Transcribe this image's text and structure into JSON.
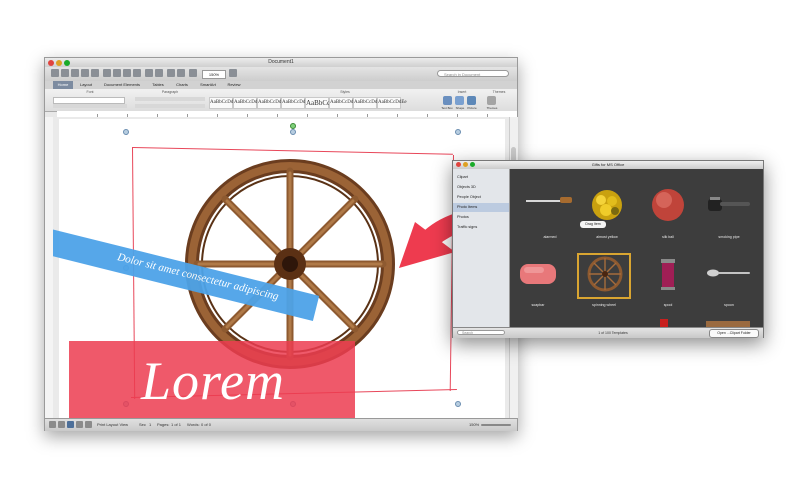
{
  "word": {
    "title": "Document1",
    "zoom": "150%",
    "search_placeholder": "Search in Document",
    "tabs": [
      "Home",
      "Layout",
      "Document Elements",
      "Tables",
      "Charts",
      "SmartArt",
      "Review"
    ],
    "active_tab": "Home",
    "ribbon_groups": [
      "Font",
      "Paragraph",
      "Styles",
      "Insert",
      "Themes"
    ],
    "styles": [
      "AaBbCcDdEe",
      "AaBbCcDdEe",
      "AaBbCcDd",
      "AaBbCcDdEe",
      "AaBbCc",
      "AaBbCcDdEe",
      "AaBbCcDdEe",
      "AaBbCcDdEe"
    ],
    "insert_labels": [
      "Text Box",
      "Shape",
      "Picture",
      "Themes"
    ],
    "status": {
      "view": "Print Layout View",
      "sec_label": "Sec",
      "sec": "1",
      "pages_label": "Pages:",
      "pages": "1 of 1",
      "words_label": "Words:",
      "words": "0 of 0",
      "zoom": "150%"
    }
  },
  "page": {
    "heading": "Lorem",
    "blue_text": "Dolor sit amet consectetur adipiscing"
  },
  "gallery": {
    "title": "Gifts for MS Office",
    "sidebar": [
      "Clipart",
      "Objects 3D",
      "People Object",
      "Photo Items",
      "Photos",
      "Traffic signs"
    ],
    "selected_category": "Photo Items",
    "tooltip": "Drag Item",
    "items": [
      {
        "label": "alarmed"
      },
      {
        "label": "almost yellow"
      },
      {
        "label": "silk ball"
      },
      {
        "label": "smoking pipe"
      },
      {
        "label": "soapbar"
      },
      {
        "label": "spinning wheel"
      },
      {
        "label": "spool"
      },
      {
        "label": "spoon"
      }
    ],
    "search_placeholder": "Search",
    "count": "1 of 100 Templates",
    "folder_button": "Open ...Clipart Folder"
  },
  "colors": {
    "accent_red": "#e8475a",
    "accent_blue": "#4da3e8",
    "selection_gold": "#d9a531"
  }
}
